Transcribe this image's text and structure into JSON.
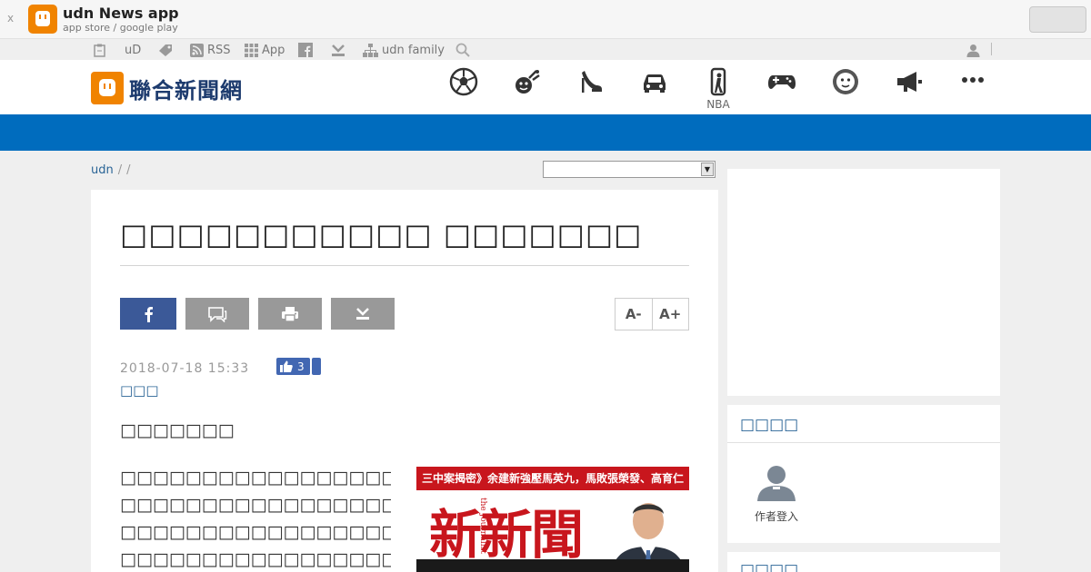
{
  "app_banner": {
    "close_label": "x",
    "title": "udn News app",
    "subtitle": "app store / google play",
    "open_button_label": ""
  },
  "utility_bar": {
    "items": [
      {
        "label": "",
        "icon": "clipboard-icon"
      },
      {
        "label": "uD",
        "icon": ""
      },
      {
        "label": "",
        "icon": "tag-icon"
      },
      {
        "label": "RSS",
        "icon": "rss-icon"
      },
      {
        "label": "App",
        "icon": "grid-icon"
      },
      {
        "label": "",
        "icon": "facebook-icon"
      },
      {
        "label": "",
        "icon": "download-icon"
      },
      {
        "label": "udn family",
        "icon": "sitemap-icon"
      },
      {
        "label": "",
        "icon": "search-icon"
      }
    ],
    "user_icon": "user-icon"
  },
  "header": {
    "brand_name": "聯合新聞網",
    "categories": [
      {
        "icon": "soccer-icon",
        "label": ""
      },
      {
        "icon": "entertainment-icon",
        "label": ""
      },
      {
        "icon": "high-heel-icon",
        "label": ""
      },
      {
        "icon": "car-icon",
        "label": ""
      },
      {
        "icon": "nba-icon",
        "label": "NBA"
      },
      {
        "icon": "gamepad-icon",
        "label": ""
      },
      {
        "icon": "emoji-icon",
        "label": ""
      },
      {
        "icon": "megaphone-icon",
        "label": ""
      },
      {
        "icon": "more-icon",
        "label": ""
      }
    ],
    "accent_color": "#006cbe",
    "brand_color": "#f08300"
  },
  "breadcrumb": {
    "root": "udn",
    "separator": "/",
    "select_value": ""
  },
  "article": {
    "headline": "□□□□□□□□□□□ □□□□□□□",
    "buttons": [
      "facebook-share",
      "comment",
      "print",
      "download"
    ],
    "font_decrease": "A-",
    "font_increase": "A+",
    "datetime": "2018-07-18 15:33",
    "like_count": "3",
    "author": "□□□",
    "lead": "□□□□□□□",
    "body_lines": [
      "□□□□□□□□□□□□□□□□□□□□□□□□□□□□□□",
      "□□□□□□□□□□□□□□□□□□□□□□□□□□□□□□",
      "□□□□□□□□□□□□□□□□□□□□□□□□□□□□□□",
      "□□□□□□□□□□□□□□□□□□□□□□□□□□□□□□"
    ],
    "cover": {
      "strip_text": "三中案揭密》余建新強壓馬英九，馬敗張榮發、高育仁",
      "masthead": "新新聞",
      "masthead_en": "the Journalist"
    }
  },
  "sidebar": {
    "card_title": "□□□□",
    "author_login_label": "作者登入",
    "card2_title": "□□□□"
  }
}
